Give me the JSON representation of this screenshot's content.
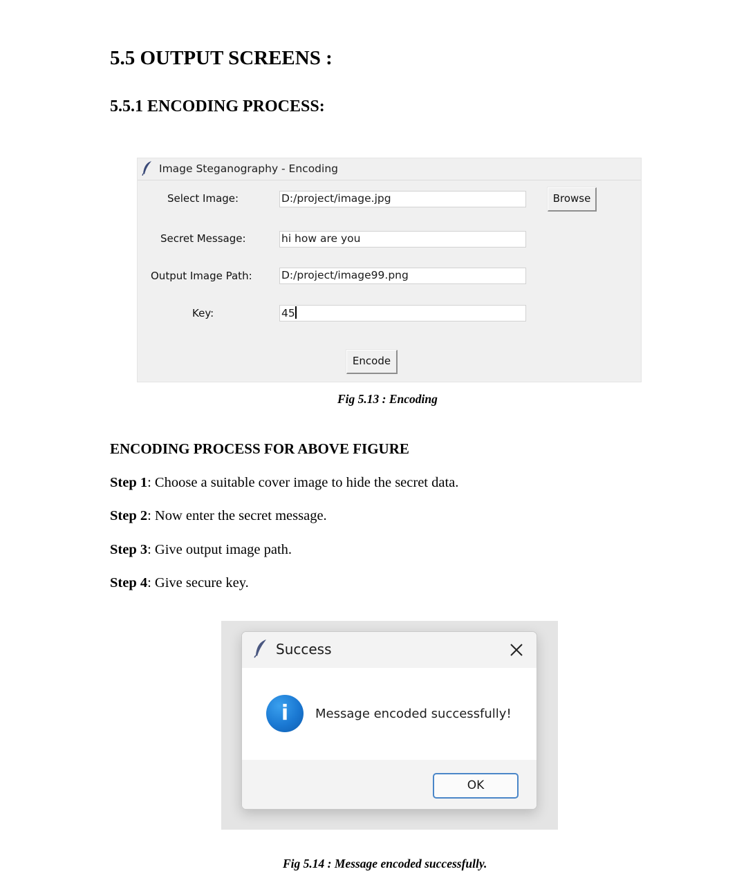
{
  "heading": "5.5 OUTPUT SCREENS :",
  "subheading": "5.5.1 ENCODING PROCESS:",
  "encoding_window": {
    "title": "Image Steganography - Encoding",
    "select_image_label": "Select Image:",
    "select_image_value": "D:/project/image.jpg",
    "browse_label": "Browse",
    "secret_message_label": "Secret Message:",
    "secret_message_value": "hi how are you",
    "output_path_label": "Output Image Path:",
    "output_path_value": "D:/project/image99.png",
    "key_label": "Key:",
    "key_value": "45",
    "encode_label": "Encode",
    "app_icon": "feather-icon"
  },
  "fig1_caption": "Fig 5.13 : Encoding",
  "section_heading": "ENCODING PROCESS FOR ABOVE FIGURE",
  "steps": [
    {
      "label": "Step 1",
      "text": ": Choose a suitable cover image to hide the secret data."
    },
    {
      "label": "Step 2",
      "text": ": Now enter the secret message."
    },
    {
      "label": "Step 3",
      "text": ": Give output image path."
    },
    {
      "label": "Step 4",
      "text": ": Give secure key."
    }
  ],
  "success_dialog": {
    "title": "Success",
    "message": "Message encoded successfully!",
    "ok_label": "OK",
    "info_glyph": "i",
    "icons": [
      "feather-icon",
      "close-icon",
      "info-icon"
    ],
    "info_color": "#1a78d2"
  },
  "fig2_caption": "Fig 5.14 : Message encoded successfully."
}
